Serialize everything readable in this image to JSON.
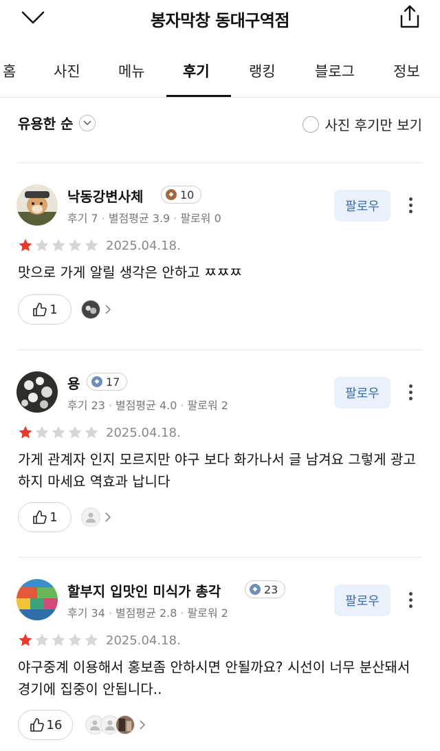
{
  "header": {
    "title": "봉자막창 동대구역점"
  },
  "tabs": [
    {
      "label": "홈"
    },
    {
      "label": "사진"
    },
    {
      "label": "메뉴"
    },
    {
      "label": "후기",
      "active": true
    },
    {
      "label": "랭킹"
    },
    {
      "label": "블로그"
    },
    {
      "label": "정보"
    }
  ],
  "sort": {
    "label": "유용한 순",
    "photo_filter_label": "사진 후기만 보기"
  },
  "colors": {
    "star_filled": "#e53b2f",
    "star_empty": "#d6d6d6",
    "follow_bg": "#eaf1fb",
    "follow_text": "#3b6bb0"
  },
  "reviews": [
    {
      "username": "낙동강변사체",
      "level": "10",
      "level_icon": "bronze-badge-icon",
      "review_count_label": "후기 7",
      "avg_rating_label": "별점평균 3.9",
      "followers_label": "팔로워 0",
      "follow_label": "팔로우",
      "rating": 1,
      "date": "2025.04.18.",
      "text": "맛으로 가게 알릴 생각은 안하고 ㅉㅉㅉ",
      "likes": "1"
    },
    {
      "username": "용",
      "level": "17",
      "level_icon": "silver-badge-icon",
      "review_count_label": "후기 23",
      "avg_rating_label": "별점평균 4.0",
      "followers_label": "팔로워 2",
      "follow_label": "팔로우",
      "rating": 1,
      "date": "2025.04.18.",
      "text": "가게 관계자 인지 모르지만 야구 보다 화가나서 글 남겨요 그렇게 광고 하지 마세요 역효과 납니다",
      "likes": "1"
    },
    {
      "username": "할부지 입맛인 미식가 총각",
      "level": "23",
      "level_icon": "silver-badge-icon",
      "review_count_label": "후기 34",
      "avg_rating_label": "별점평균 2.8",
      "followers_label": "팔로워 2",
      "follow_label": "팔로우",
      "rating": 1,
      "date": "2025.04.18.",
      "text": "야구중계 이용해서 홍보좀 안하시면 안될까요? 시선이 너무 분산돼서 경기에 집중이 안됩니다..",
      "likes": "16"
    }
  ]
}
